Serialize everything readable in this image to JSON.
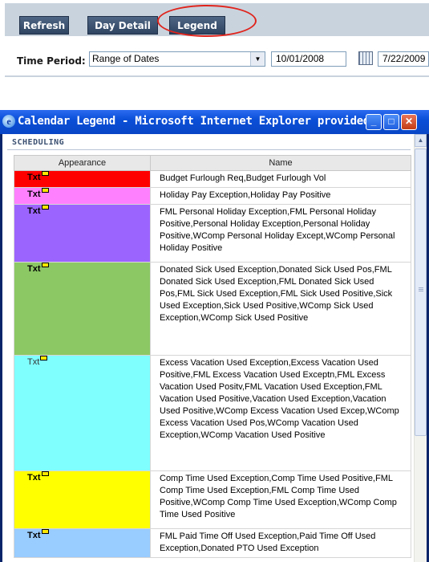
{
  "toolbar": {
    "buttons": [
      "Refresh",
      "Day Detail",
      "Legend"
    ]
  },
  "filter": {
    "time_period_label": "Time Period:",
    "range_select": "Range of Dates",
    "start_date": "10/01/2008",
    "end_date": "7/22/2009"
  },
  "window": {
    "title": "Calendar Legend - Microsoft Internet Explorer provided...",
    "section_title": "SCHEDULING",
    "columns": [
      "Appearance",
      "Name"
    ],
    "swatch_text": "Txt",
    "rows": [
      {
        "color": "#ff0000",
        "name": "Budget Furlough Req,Budget Furlough Vol"
      },
      {
        "color": "#ff80ff",
        "name": "Holiday Pay Exception,Holiday Pay Positive"
      },
      {
        "color": "#9c64ff",
        "name": "FML Personal Holiday Exception,FML Personal Holiday Positive,Personal Holiday Exception,Personal Holiday Positive,WComp Personal Holiday Except,WComp Personal Holiday Positive"
      },
      {
        "color": "#8cc864",
        "name": "Donated Sick Used Exception,Donated Sick Used Pos,FML Donated Sick Used Exception,FML Donated Sick Used Pos,FML Sick Used Exception,FML Sick Used Positive,Sick Used Exception,Sick Used Positive,WComp Sick Used Exception,WComp Sick Used Positive"
      },
      {
        "color": "#80ffff",
        "name": "Excess Vacation Used Exception,Excess Vacation Used Positive,FML Excess Vacation Used Exceptn,FML Excess Vacation Used Positv,FML Vacation Used Exception,FML Vacation Used Positive,Vacation Used Exception,Vacation Used Positive,WComp Excess Vacation Used Excep,WComp Excess Vacation Used Pos,WComp Vacation Used Exception,WComp Vacation Used Positive"
      },
      {
        "color": "#ffff00",
        "name": "Comp Time Used Exception,Comp Time Used Positive,FML Comp Time Used Exception,FML Comp Time Used Positive,WComp Comp Time Used Exception,WComp Comp Time Used Positive"
      },
      {
        "color": "#99ccff",
        "name": "FML Paid Time Off Used Exception,Paid Time Off Used Exception,Donated PTO Used Exception"
      }
    ]
  }
}
